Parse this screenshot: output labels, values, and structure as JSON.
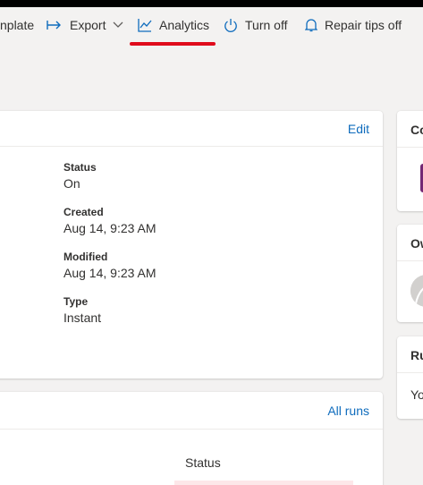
{
  "commandbar": {
    "template_label": "nplate",
    "export_label": "Export",
    "analytics_label": "Analytics",
    "turnoff_label": "Turn off",
    "repair_label": "Repair tips off",
    "active_tab": "Analytics"
  },
  "colors": {
    "accent": "#0f6cbd",
    "active_underline": "#e00b1c",
    "purple": "#742774",
    "background": "#f3f2f1"
  },
  "details": {
    "edit_label": "Edit",
    "status_label": "Status",
    "status_value": "On",
    "created_label": "Created",
    "created_value": "Aug 14, 9:23 AM",
    "modified_label": "Modified",
    "modified_value": "Aug 14, 9:23 AM",
    "type_label": "Type",
    "type_value": "Instant"
  },
  "runs": {
    "all_runs_label": "All runs",
    "status_column": "Status"
  },
  "side": {
    "card1_title": "Co",
    "card2_title": "Ow",
    "card3_title": "Ru",
    "card3_text": "Yo"
  },
  "icons": {
    "export": "export-arrow-icon",
    "analytics": "line-chart-icon",
    "turnoff": "power-icon",
    "repair": "bell-icon",
    "chevron": "chevron-down-icon"
  }
}
